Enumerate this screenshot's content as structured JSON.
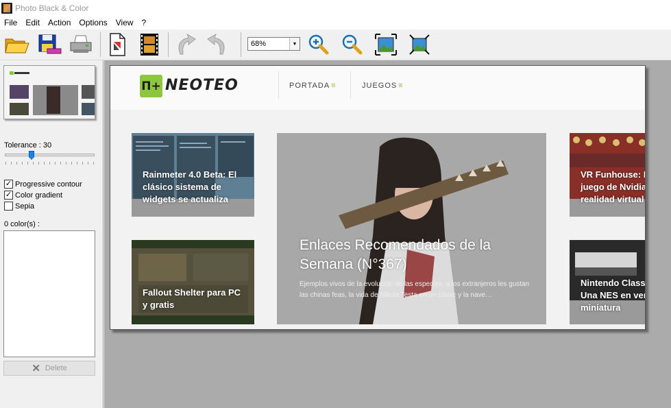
{
  "window": {
    "title": "Photo Black & Color"
  },
  "menu": [
    "File",
    "Edit",
    "Action",
    "Options",
    "View",
    "?"
  ],
  "toolbar": {
    "buttons": [
      "open-folder",
      "save",
      "print",
      "document",
      "film",
      "undo",
      "redo",
      "zoom-in",
      "zoom-out",
      "fit-window",
      "actual-size"
    ],
    "zoom_value": "68%"
  },
  "panel": {
    "tolerance_label": "Tolerance : 30",
    "tolerance_value": 30,
    "options": [
      {
        "label": "Progressive contour",
        "checked": true
      },
      {
        "label": "Color gradient",
        "checked": true
      },
      {
        "label": "Sepia",
        "checked": false
      }
    ],
    "colors_label": "0 color(s) :",
    "delete_label": "Delete"
  },
  "site": {
    "logo_mark": "П+",
    "logo_name": "NEOTEO",
    "nav": [
      "PORTADA",
      "JUEGOS"
    ],
    "cards": {
      "rainmeter": "Rainmeter 4.0 Beta: El clásico sistema de widgets se actualiza",
      "fallout": "Fallout Shelter para PC y gratis",
      "vr": "VR Funhouse: N juego de Nvidia realidad virtual",
      "nes": "Nintendo Classi Una NES en vers miniatura"
    },
    "hero": {
      "title": "Enlaces Recomendados de la Semana (N°367)",
      "desc": "Ejemplos vivos de la evolución de las especies, a los extranjeros les gustan las chinas feas, la vida de Nikola Testa en un cómic y la nave…"
    }
  },
  "colors": {
    "accent": "#8dc63f",
    "canvas_bg": "#ababab",
    "slider": "#1e80e0"
  }
}
